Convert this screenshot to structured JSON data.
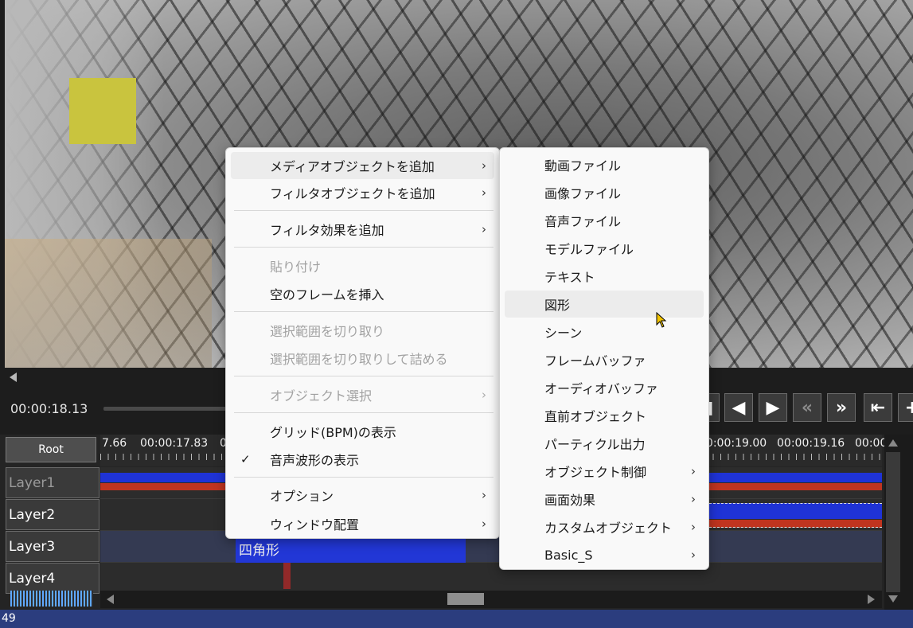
{
  "preview": {
    "accent_square_color": "#c9c43e"
  },
  "controls": {
    "current_time": "00:00:18.13",
    "buttons": [
      "stop-button",
      "prev-frame-button",
      "next-frame-button",
      "rewind-button",
      "fast-forward-button",
      "go-start-button",
      "add-button"
    ]
  },
  "timeline": {
    "root_label": "Root",
    "ruler_labels": [
      "7.66",
      "00:00:17.83",
      "0",
      "00:00:19.00",
      "00:00:19.16",
      "00:00"
    ],
    "layers": [
      "Layer1",
      "Layer2",
      "Layer3",
      "Layer4"
    ],
    "clip_label": "四角形"
  },
  "status": {
    "text": "49"
  },
  "context_menu": {
    "items": [
      {
        "label": "メディアオブジェクトを追加",
        "submenu": true,
        "enabled": true,
        "highlighted": true
      },
      {
        "label": "フィルタオブジェクトを追加",
        "submenu": true,
        "enabled": true
      },
      {
        "label": "フィルタ効果を追加",
        "submenu": true,
        "enabled": true
      },
      {
        "label": "貼り付け",
        "submenu": false,
        "enabled": false
      },
      {
        "label": "空のフレームを挿入",
        "submenu": false,
        "enabled": true
      },
      {
        "label": "選択範囲を切り取り",
        "submenu": false,
        "enabled": false
      },
      {
        "label": "選択範囲を切り取りして詰める",
        "submenu": false,
        "enabled": false
      },
      {
        "label": "オブジェクト選択",
        "submenu": true,
        "enabled": false
      },
      {
        "label": "グリッド(BPM)の表示",
        "submenu": false,
        "enabled": true
      },
      {
        "label": "音声波形の表示",
        "submenu": false,
        "enabled": true,
        "checked": true
      },
      {
        "label": "オプション",
        "submenu": true,
        "enabled": true
      },
      {
        "label": "ウィンドウ配置",
        "submenu": true,
        "enabled": true
      }
    ]
  },
  "submenu": {
    "items": [
      {
        "label": "動画ファイル",
        "submenu": false
      },
      {
        "label": "画像ファイル",
        "submenu": false
      },
      {
        "label": "音声ファイル",
        "submenu": false
      },
      {
        "label": "モデルファイル",
        "submenu": false
      },
      {
        "label": "テキスト",
        "submenu": false
      },
      {
        "label": "図形",
        "submenu": false,
        "highlighted": true
      },
      {
        "label": "シーン",
        "submenu": false
      },
      {
        "label": "フレームバッファ",
        "submenu": false
      },
      {
        "label": "オーディオバッファ",
        "submenu": false
      },
      {
        "label": "直前オブジェクト",
        "submenu": false
      },
      {
        "label": "パーティクル出力",
        "submenu": false
      },
      {
        "label": "オブジェクト制御",
        "submenu": true
      },
      {
        "label": "画面効果",
        "submenu": true
      },
      {
        "label": "カスタムオブジェクト",
        "submenu": true
      },
      {
        "label": "Basic_S",
        "submenu": true
      }
    ]
  },
  "icons": {
    "submenu_arrow": "chevron-right-icon",
    "check": "check-icon"
  }
}
